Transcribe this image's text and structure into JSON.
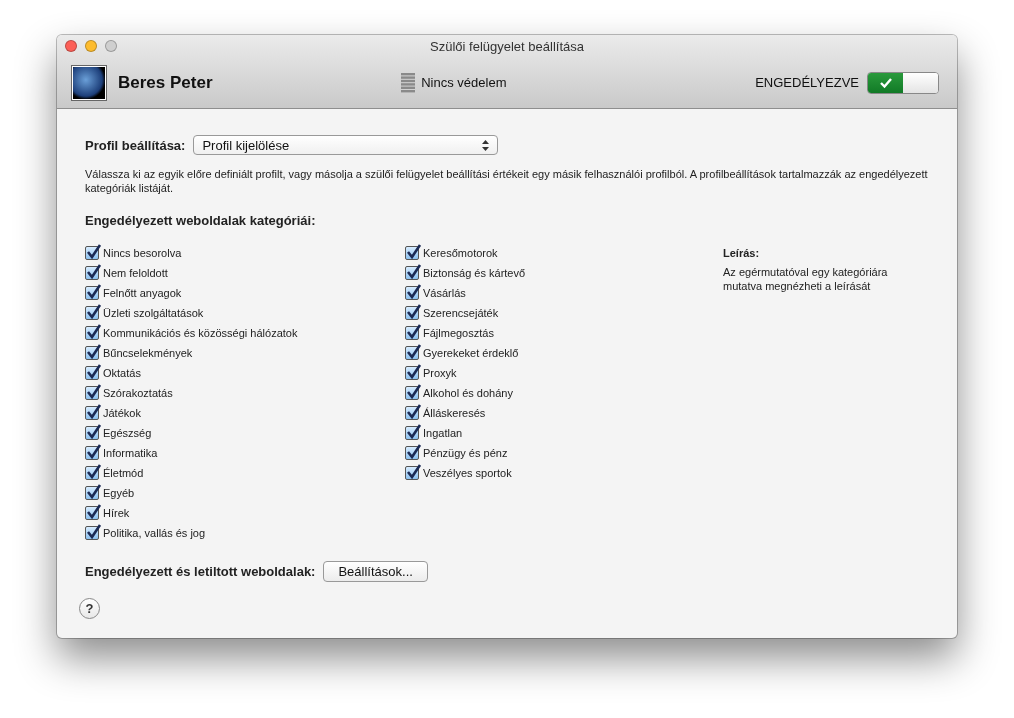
{
  "window": {
    "title": "Szülői felügyelet beállítása"
  },
  "header": {
    "user_name": "Beres Peter",
    "protection_status": "Nincs védelem",
    "enabled": {
      "label": "ENGEDÉLYEZVE",
      "on": true
    }
  },
  "profile": {
    "label": "Profil beállítása:",
    "value": "Profil kijelölése",
    "description": "Válassza ki az egyik előre definiált profilt, vagy másolja a szülői felügyelet beállítási értékeit egy másik felhasználói profilból. A profilbeállítások tartalmazzák az engedélyezett kategóriák listáját."
  },
  "categories": {
    "title": "Engedélyezett weboldalak kategóriái:",
    "columns": [
      [
        {
          "label": "Nincs besorolva",
          "checked": true
        },
        {
          "label": "Nem feloldott",
          "checked": true
        },
        {
          "label": "Felnőtt anyagok",
          "checked": true
        },
        {
          "label": "Üzleti szolgáltatások",
          "checked": true
        },
        {
          "label": "Kommunikációs és közösségi hálózatok",
          "checked": true
        },
        {
          "label": "Bűncselekmények",
          "checked": true
        },
        {
          "label": "Oktatás",
          "checked": true
        },
        {
          "label": "Szórakoztatás",
          "checked": true
        },
        {
          "label": "Játékok",
          "checked": true
        },
        {
          "label": "Egészség",
          "checked": true
        },
        {
          "label": "Informatika",
          "checked": true
        },
        {
          "label": "Életmód",
          "checked": true
        },
        {
          "label": "Egyéb",
          "checked": true
        },
        {
          "label": "Hírek",
          "checked": true
        },
        {
          "label": "Politika, vallás és jog",
          "checked": true
        }
      ],
      [
        {
          "label": "Keresőmotorok",
          "checked": true
        },
        {
          "label": "Biztonság és kártevő",
          "checked": true
        },
        {
          "label": "Vásárlás",
          "checked": true
        },
        {
          "label": "Szerencsejáték",
          "checked": true
        },
        {
          "label": "Fájlmegosztás",
          "checked": true
        },
        {
          "label": "Gyerekeket érdeklő",
          "checked": true
        },
        {
          "label": "Proxyk",
          "checked": true
        },
        {
          "label": "Alkohol és dohány",
          "checked": true
        },
        {
          "label": "Álláskeresés",
          "checked": true
        },
        {
          "label": "Ingatlan",
          "checked": true
        },
        {
          "label": "Pénzügy és pénz",
          "checked": true
        },
        {
          "label": "Veszélyes sportok",
          "checked": true
        }
      ]
    ],
    "description_title": "Leírás:",
    "description_text": "Az egérmutatóval egy kategóriára mutatva megnézheti a leírását"
  },
  "websites": {
    "label": "Engedélyezett és letiltott weboldalak:",
    "button": "Beállítások..."
  },
  "help": "?"
}
